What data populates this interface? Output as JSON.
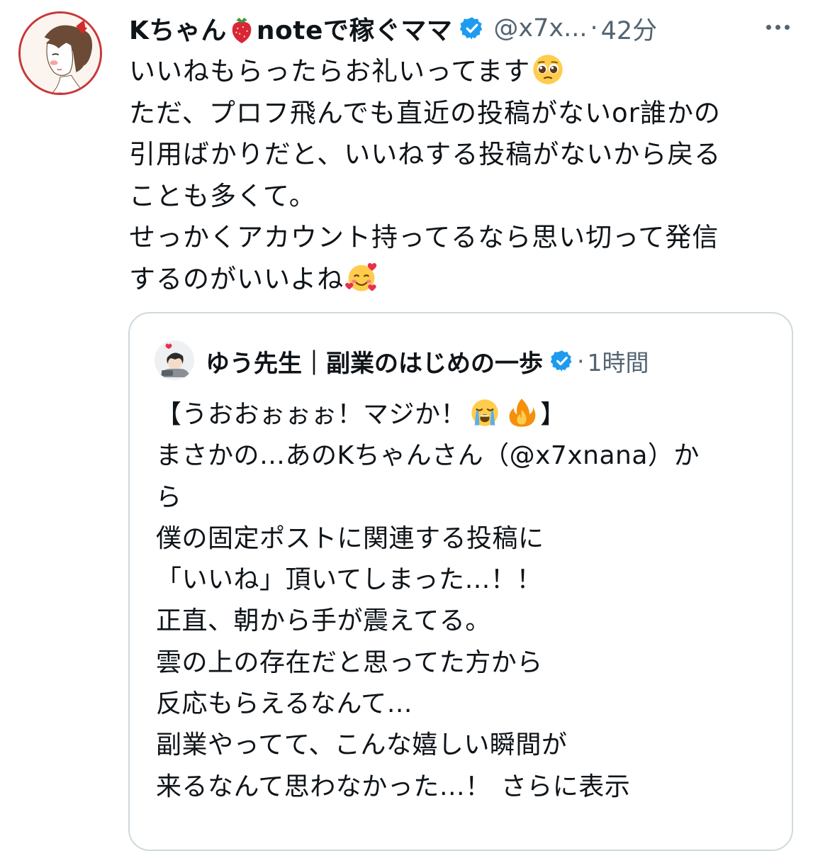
{
  "post": {
    "display_name_prefix": "Kちゃん",
    "display_name_suffix": "noteで稼ぐママ",
    "handle": "@x7x...",
    "separator": "·",
    "time": "42分",
    "body_lines": [
      "いいねもらったらお礼いってます",
      "ただ、プロフ飛んでも直近の投稿がないor誰かの",
      "引用ばかりだと、いいねする投稿がないから戻る",
      "ことも多くて。",
      "せっかくアカウント持ってるなら思い切って発信",
      "するのがいいよね"
    ],
    "icons": {
      "strawberry": "strawberry-emoji",
      "verified": "verified-badge-icon",
      "more": "more-options-icon",
      "pleading": "pleading-face-emoji",
      "smiling_hearts": "smiling-face-with-hearts-emoji"
    }
  },
  "quote": {
    "display_name": "ゆう先生｜副業のはじめの一歩",
    "separator": "·",
    "time": "1時間",
    "first_line_open": "【うおおぉぉぉ！マジか！",
    "first_line_close": "】",
    "body_lines": [
      "まさかの…あのKちゃんさん（@x7xnana）か",
      "ら",
      "僕の固定ポストに関連する投稿に",
      "「いいね」頂いてしまった…！！",
      "正直、朝から手が震えてる。",
      "雲の上の存在だと思ってた方から",
      "反応もらえるなんて…",
      "副業やってて、こんな嬉しい瞬間が"
    ],
    "last_line": "来るなんて思わなかった…！",
    "show_more": "さらに表示",
    "icons": {
      "crying": "loudly-crying-face-emoji",
      "fire": "fire-emoji"
    }
  },
  "colors": {
    "text": "#0f1419",
    "secondary": "#536471",
    "verified": "#1d9bf0",
    "border": "#cfd9de",
    "avatar_ring": "#c8373a"
  }
}
